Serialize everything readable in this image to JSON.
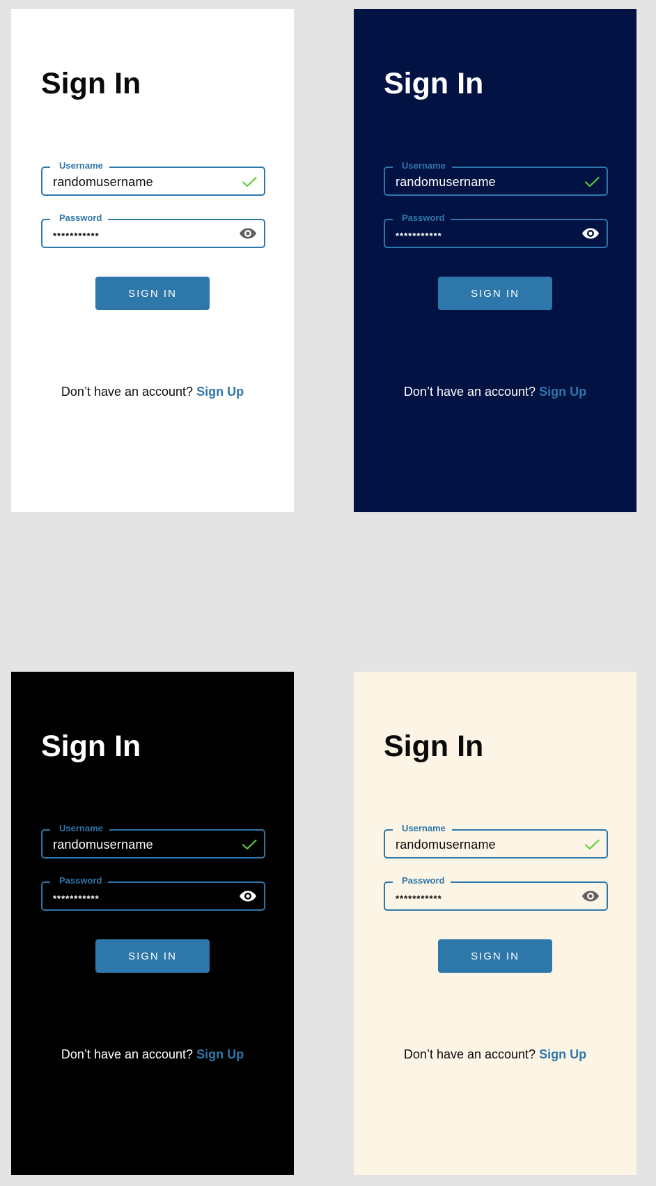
{
  "colors": {
    "accent": "#2e77aa",
    "success": "#5dcc3e",
    "canvas": "#e4e4e4",
    "light_bg": "#ffffff",
    "navy_bg": "#021242",
    "black_bg": "#000000",
    "cream_bg": "#fcf5e6"
  },
  "icons": {
    "username_status": "check-icon",
    "password_toggle": "eye-icon"
  },
  "screens": [
    {
      "theme": "light",
      "title": "Sign In",
      "username": {
        "label": "Username",
        "value": "randomusername"
      },
      "password": {
        "label": "Password",
        "value": "***********"
      },
      "button_label": "SIGN IN",
      "signup_prompt": "Don’t have an account?",
      "signup_link": "Sign Up"
    },
    {
      "theme": "navy",
      "title": "Sign In",
      "username": {
        "label": "Username",
        "value": "randomusername"
      },
      "password": {
        "label": "Password",
        "value": "***********"
      },
      "button_label": "SIGN IN",
      "signup_prompt": "Don’t have an account?",
      "signup_link": "Sign Up"
    },
    {
      "theme": "black",
      "title": "Sign In",
      "username": {
        "label": "Username",
        "value": "randomusername"
      },
      "password": {
        "label": "Password",
        "value": "***********"
      },
      "button_label": "SIGN IN",
      "signup_prompt": "Don’t have an account?",
      "signup_link": "Sign Up"
    },
    {
      "theme": "cream",
      "title": "Sign In",
      "username": {
        "label": "Username",
        "value": "randomusername"
      },
      "password": {
        "label": "Password",
        "value": "***********"
      },
      "button_label": "SIGN IN",
      "signup_prompt": "Don’t have an account?",
      "signup_link": "Sign Up"
    }
  ]
}
